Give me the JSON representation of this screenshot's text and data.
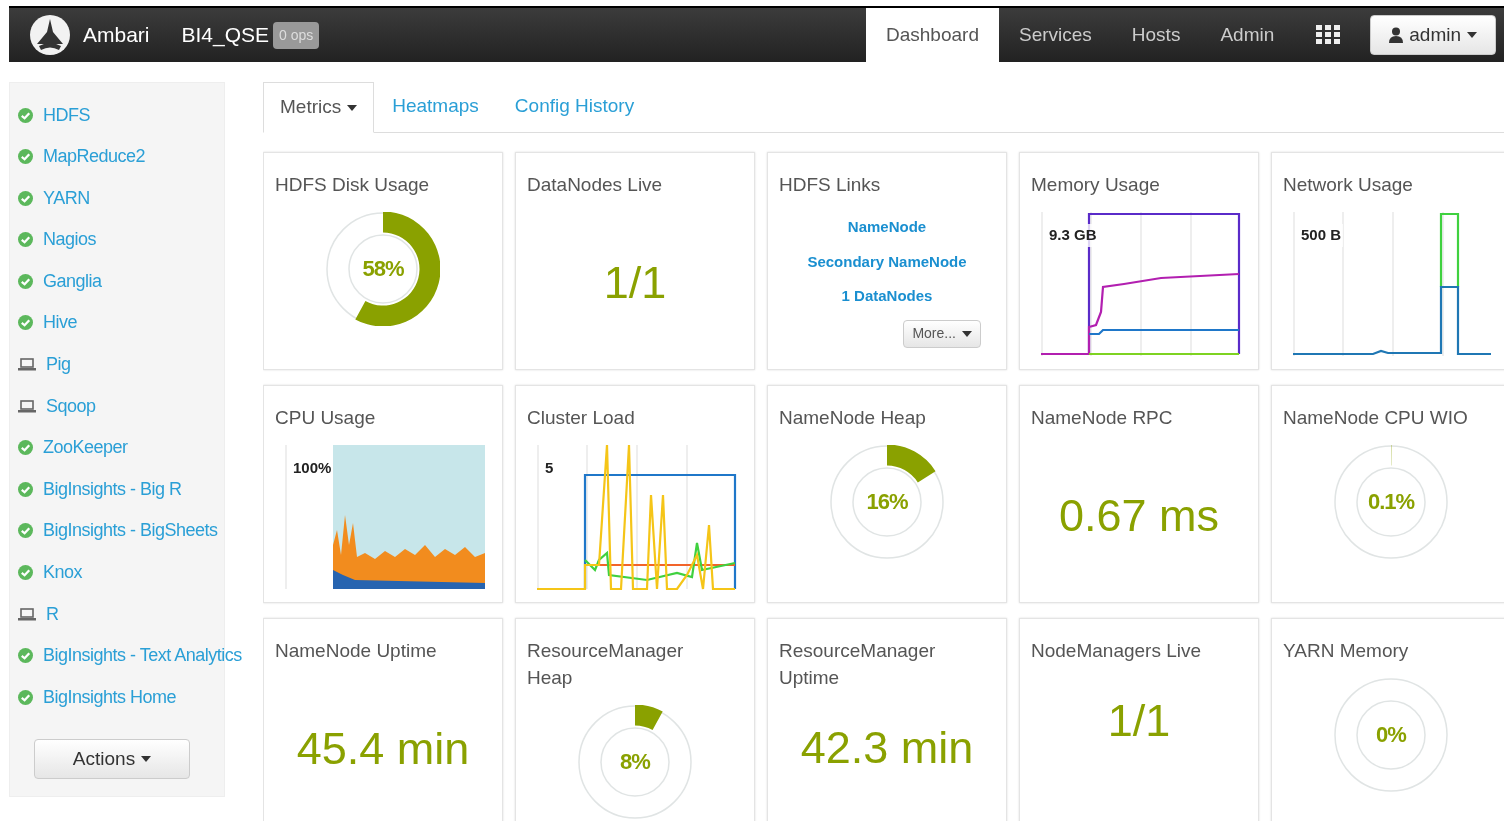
{
  "topbar": {
    "app_name": "Ambari",
    "cluster_name": "BI4_QSE",
    "ops_badge": "0 ops",
    "nav": [
      {
        "label": "Dashboard",
        "selected": true
      },
      {
        "label": "Services",
        "selected": false
      },
      {
        "label": "Hosts",
        "selected": false
      },
      {
        "label": "Admin",
        "selected": false
      }
    ],
    "user_menu": "admin"
  },
  "sidebar": {
    "items": [
      {
        "label": "HDFS",
        "kind": "started"
      },
      {
        "label": "MapReduce2",
        "kind": "started"
      },
      {
        "label": "YARN",
        "kind": "started"
      },
      {
        "label": "Nagios",
        "kind": "started"
      },
      {
        "label": "Ganglia",
        "kind": "started"
      },
      {
        "label": "Hive",
        "kind": "started"
      },
      {
        "label": "Pig",
        "kind": "client"
      },
      {
        "label": "Sqoop",
        "kind": "client"
      },
      {
        "label": "ZooKeeper",
        "kind": "started"
      },
      {
        "label": "BigInsights - Big R",
        "kind": "started"
      },
      {
        "label": "BigInsights - BigSheets",
        "kind": "started"
      },
      {
        "label": "Knox",
        "kind": "started"
      },
      {
        "label": "R",
        "kind": "client"
      },
      {
        "label": "BigInsights - Text Analytics",
        "kind": "started"
      },
      {
        "label": "BigInsights Home",
        "kind": "started"
      }
    ],
    "actions_button": "Actions"
  },
  "subtabs": [
    {
      "label": "Metrics",
      "selected": true,
      "dropdown": true
    },
    {
      "label": "Heatmaps",
      "selected": false,
      "dropdown": false
    },
    {
      "label": "Config History",
      "selected": false,
      "dropdown": false
    }
  ],
  "widgets": [
    {
      "kind": "donut",
      "title": "HDFS Disk Usage",
      "value": "58%"
    },
    {
      "kind": "number",
      "title": "DataNodes Live",
      "value": "1/1"
    },
    {
      "kind": "links",
      "title": "HDFS Links",
      "links": [
        "NameNode",
        "Secondary NameNode",
        "1 DataNodes"
      ],
      "more_button": "More..."
    },
    {
      "kind": "chart",
      "title": "Memory Usage",
      "axis_label": "9.3 GB"
    },
    {
      "kind": "chart",
      "title": "Network Usage",
      "axis_label": "500 B"
    },
    {
      "kind": "chart",
      "title": "CPU Usage",
      "axis_label": "100%"
    },
    {
      "kind": "chart",
      "title": "Cluster Load",
      "axis_label": "5"
    },
    {
      "kind": "donut",
      "title": "NameNode Heap",
      "value": "16%"
    },
    {
      "kind": "number",
      "title": "NameNode RPC",
      "value": "0.67 ms"
    },
    {
      "kind": "donut",
      "title": "NameNode CPU WIO",
      "value": "0.1%"
    },
    {
      "kind": "number",
      "title": "NameNode Uptime",
      "value": "45.4 min"
    },
    {
      "kind": "donut",
      "title": "ResourceManager Heap",
      "value": "8%"
    },
    {
      "kind": "number",
      "title": "ResourceManager Uptime",
      "value": "42.3 min"
    },
    {
      "kind": "number",
      "title": "NodeManagers Live",
      "value": "1/1"
    },
    {
      "kind": "donut",
      "title": "YARN Memory",
      "value": "0%"
    }
  ]
}
